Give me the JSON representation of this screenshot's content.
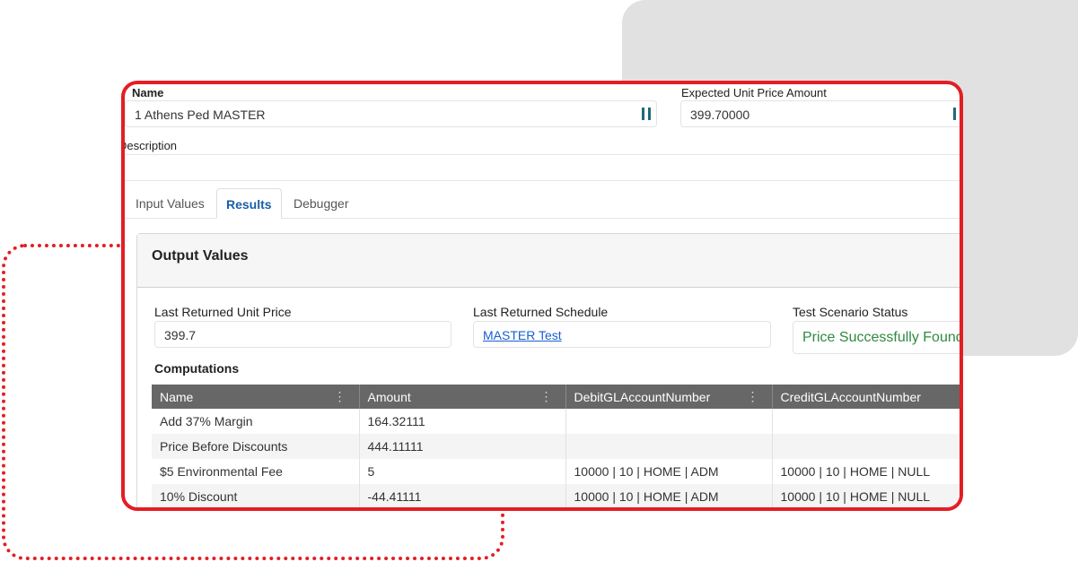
{
  "form": {
    "name_label": "Name",
    "name_value": "1 Athens Ped MASTER",
    "expected_label": "Expected Unit Price Amount",
    "expected_value": "399.70000",
    "description_label": "Description"
  },
  "tabs": [
    {
      "label": "Input Values"
    },
    {
      "label": "Results"
    },
    {
      "label": "Debugger"
    }
  ],
  "output": {
    "title": "Output Values",
    "last_price_label": "Last Returned Unit Price",
    "last_price_value": "399.7",
    "last_schedule_label": "Last Returned Schedule",
    "last_schedule_value": "MASTER Test",
    "status_label": "Test Scenario Status",
    "status_value": "Price Successfully Found",
    "status_color": "#2e8b3e"
  },
  "computations": {
    "title": "Computations",
    "columns": [
      "Name",
      "Amount",
      "DebitGLAccountNumber",
      "CreditGLAccountNumber"
    ],
    "rows": [
      [
        "Add 37% Margin",
        "164.32111",
        "",
        ""
      ],
      [
        "Price Before Discounts",
        "444.11111",
        "",
        ""
      ],
      [
        "$5 Environmental Fee",
        "5",
        "10000 | 10 | HOME | ADM",
        "10000 | 10 | HOME | NULL"
      ],
      [
        "10% Discount",
        "-44.41111",
        "10000 | 10 | HOME | ADM",
        "10000 | 10 | HOME | NULL"
      ]
    ]
  }
}
